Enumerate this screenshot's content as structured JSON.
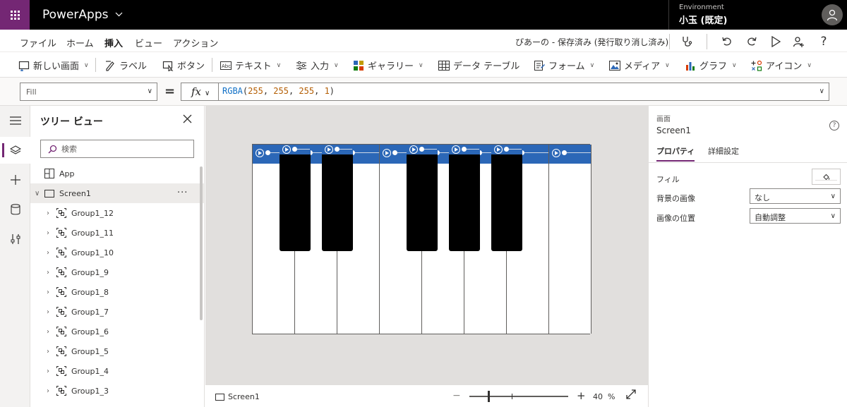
{
  "titlebar": {
    "app_name": "PowerApps",
    "environment_label": "Environment",
    "environment_value": "小玉 (既定)"
  },
  "menubar": {
    "items": [
      "ファイル",
      "ホーム",
      "挿入",
      "ビュー",
      "アクション"
    ],
    "active_item": "挿入",
    "save_status": "ぴあーの - 保存済み (発行取り消し済み)",
    "icons": [
      "stethoscope-icon",
      "undo-icon",
      "redo-icon",
      "play-icon",
      "user-share-icon",
      "help-icon"
    ],
    "help_glyph": "?"
  },
  "ribbon": {
    "items": [
      {
        "label": "新しい画面",
        "icon": "new-screen-icon",
        "dropdown": true
      },
      {
        "label": "ラベル",
        "icon": "label-icon",
        "dropdown": false
      },
      {
        "label": "ボタン",
        "icon": "button-icon",
        "dropdown": false
      },
      {
        "label": "テキスト",
        "icon": "text-icon",
        "dropdown": true
      },
      {
        "label": "入力",
        "icon": "input-icon",
        "dropdown": true
      },
      {
        "label": "ギャラリー",
        "icon": "gallery-icon",
        "dropdown": true
      },
      {
        "label": "データ テーブル",
        "icon": "data-table-icon",
        "dropdown": false
      },
      {
        "label": "フォーム",
        "icon": "form-icon",
        "dropdown": true
      },
      {
        "label": "メディア",
        "icon": "media-icon",
        "dropdown": true
      },
      {
        "label": "グラフ",
        "icon": "chart-icon",
        "dropdown": true
      },
      {
        "label": "アイコン",
        "icon": "icons-icon",
        "dropdown": true
      }
    ]
  },
  "formulabar": {
    "property": "Fill",
    "equals": "=",
    "fx_label": "fx",
    "formula": {
      "fn": "RGBA",
      "args": [
        "255",
        "255",
        "255",
        "1"
      ]
    }
  },
  "rail": {
    "items": [
      "hamburger-icon",
      "layers-icon",
      "plus-icon",
      "database-icon",
      "tools-icon"
    ],
    "active_index": 1
  },
  "treeview": {
    "title": "ツリー ビュー",
    "search_placeholder": "検索",
    "app_label": "App",
    "screen_label": "Screen1",
    "more": "···",
    "groups": [
      "Group1_12",
      "Group1_11",
      "Group1_10",
      "Group1_9",
      "Group1_8",
      "Group1_7",
      "Group1_6",
      "Group1_5",
      "Group1_4",
      "Group1_3"
    ]
  },
  "canvas": {
    "white_keys": 8,
    "black_keys_after_white": [
      0,
      1,
      3,
      4,
      5
    ],
    "colors": {
      "key_header": "#2b67b7",
      "black_key": "#000000",
      "white_key": "#ffffff",
      "canvas_bg": "#e1dfdd"
    }
  },
  "statusbar": {
    "screen_name": "Screen1",
    "minus": "−",
    "plus": "+",
    "zoom_value": "40",
    "zoom_unit": "%",
    "zoom_level": 40
  },
  "properties": {
    "control_type": "画面",
    "control_name": "Screen1",
    "help_glyph": "?",
    "tabs": [
      "プロパティ",
      "詳細設定"
    ],
    "active_tab": "プロパティ",
    "fill_label": "フィル",
    "fill_color": "#ffffff",
    "background_image_label": "背景の画像",
    "background_image_value": "なし",
    "image_position_label": "画像の位置",
    "image_position_value": "自動調整"
  },
  "colors": {
    "brand": "#742774",
    "titlebar_bg": "#000000"
  }
}
